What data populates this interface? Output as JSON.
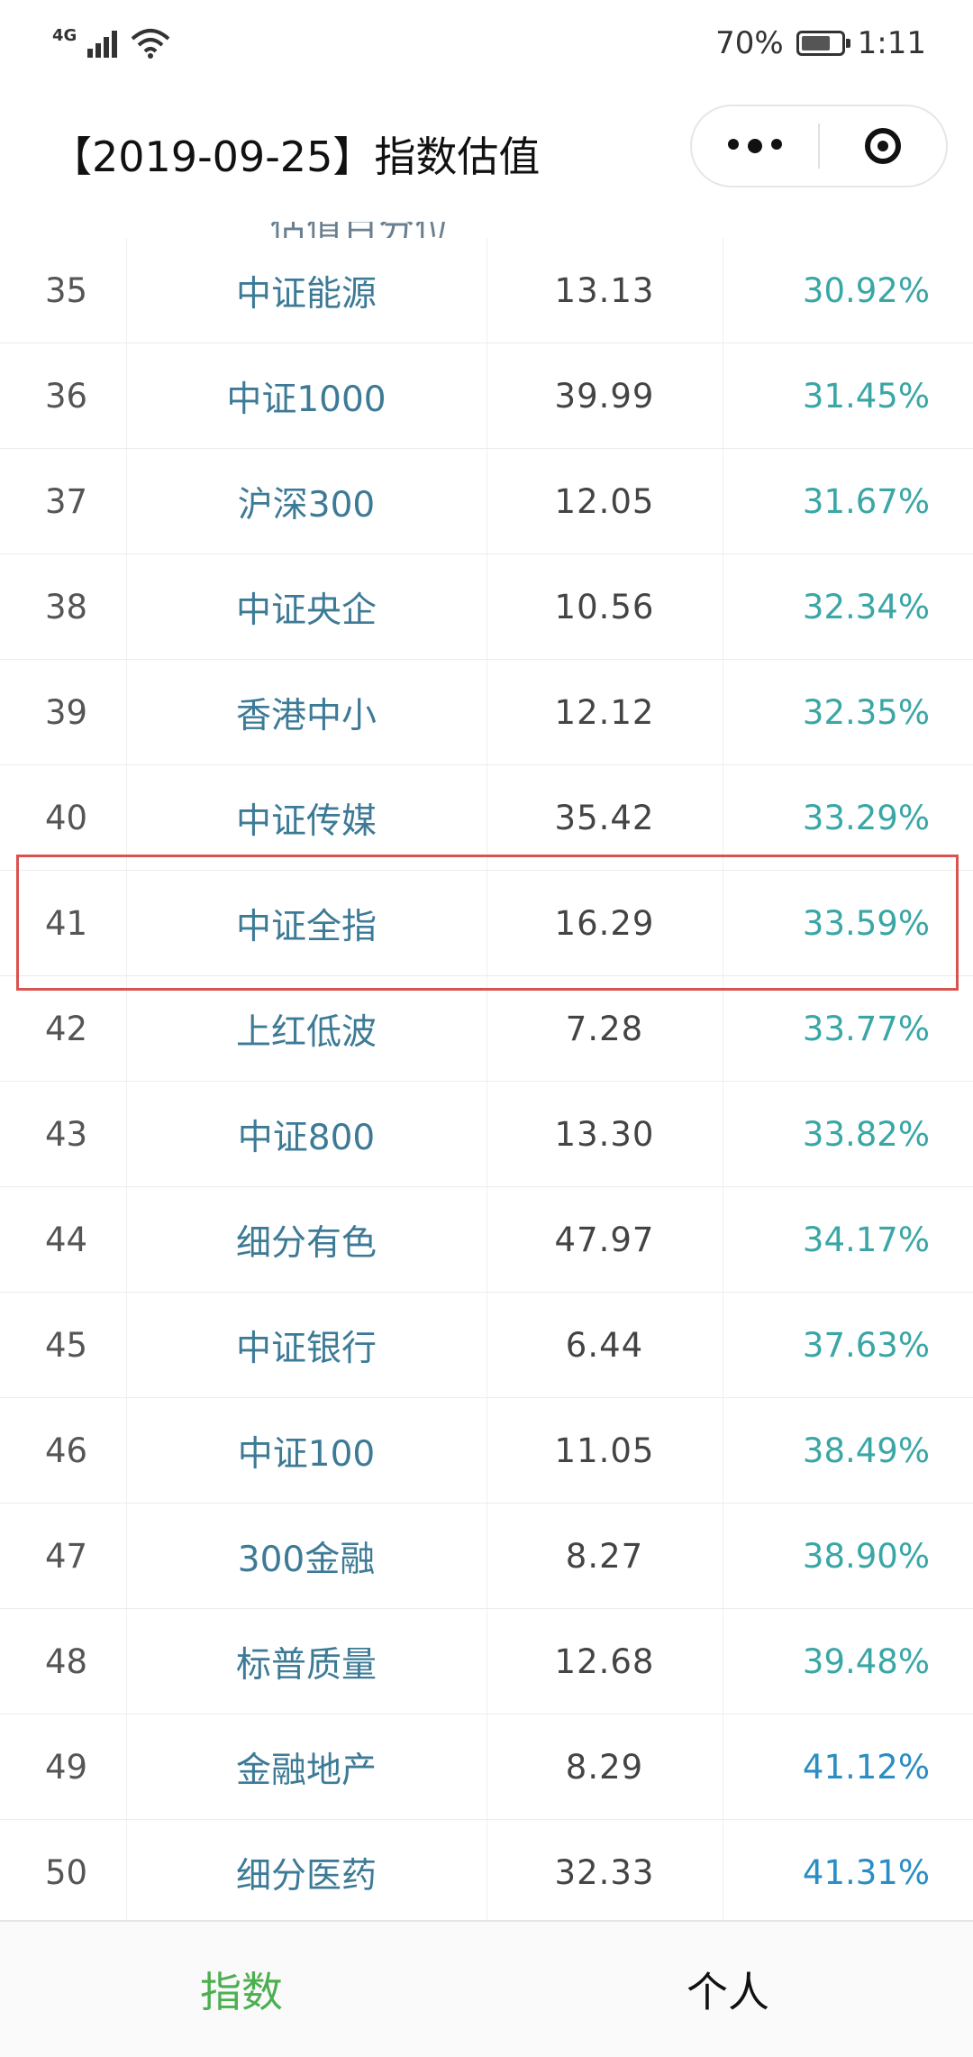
{
  "status_bar": {
    "network": "4G",
    "battery": "70%",
    "time": "1:11"
  },
  "header": {
    "title": "【2019-09-25】指数估值"
  },
  "table": {
    "clipped_header_fragment": "估值百分位",
    "rows": [
      {
        "rank": "35",
        "name": "中证能源",
        "pe": "13.13",
        "percentile": "30.92%",
        "color": "#3aa6a6"
      },
      {
        "rank": "36",
        "name": "中证1000",
        "pe": "39.99",
        "percentile": "31.45%",
        "color": "#3aa6a6"
      },
      {
        "rank": "37",
        "name": "沪深300",
        "pe": "12.05",
        "percentile": "31.67%",
        "color": "#3aa6a6"
      },
      {
        "rank": "38",
        "name": "中证央企",
        "pe": "10.56",
        "percentile": "32.34%",
        "color": "#3aa6a6"
      },
      {
        "rank": "39",
        "name": "香港中小",
        "pe": "12.12",
        "percentile": "32.35%",
        "color": "#3aa6a6"
      },
      {
        "rank": "40",
        "name": "中证传媒",
        "pe": "35.42",
        "percentile": "33.29%",
        "color": "#3aa6a6"
      },
      {
        "rank": "41",
        "name": "中证全指",
        "pe": "16.29",
        "percentile": "33.59%",
        "color": "#3aa6a6",
        "highlighted": true
      },
      {
        "rank": "42",
        "name": "上红低波",
        "pe": "7.28",
        "percentile": "33.77%",
        "color": "#3aa6a6"
      },
      {
        "rank": "43",
        "name": "中证800",
        "pe": "13.30",
        "percentile": "33.82%",
        "color": "#3aa6a6"
      },
      {
        "rank": "44",
        "name": "细分有色",
        "pe": "47.97",
        "percentile": "34.17%",
        "color": "#3aa6a6"
      },
      {
        "rank": "45",
        "name": "中证银行",
        "pe": "6.44",
        "percentile": "37.63%",
        "color": "#3aa6a6"
      },
      {
        "rank": "46",
        "name": "中证100",
        "pe": "11.05",
        "percentile": "38.49%",
        "color": "#3aa6a6"
      },
      {
        "rank": "47",
        "name": "300金融",
        "pe": "8.27",
        "percentile": "38.90%",
        "color": "#3aa6a6"
      },
      {
        "rank": "48",
        "name": "标普质量",
        "pe": "12.68",
        "percentile": "39.48%",
        "color": "#3aa6a6"
      },
      {
        "rank": "49",
        "name": "金融地产",
        "pe": "8.29",
        "percentile": "41.12%",
        "color": "#2a8dc4"
      },
      {
        "rank": "50",
        "name": "细分医药",
        "pe": "32.33",
        "percentile": "41.31%",
        "color": "#2a8dc4"
      }
    ]
  },
  "tabs": [
    {
      "label": "指数",
      "active": true,
      "color": "#4caf50"
    },
    {
      "label": "个人",
      "active": false,
      "color": "#111111"
    }
  ],
  "highlight_color": "#d9534f"
}
